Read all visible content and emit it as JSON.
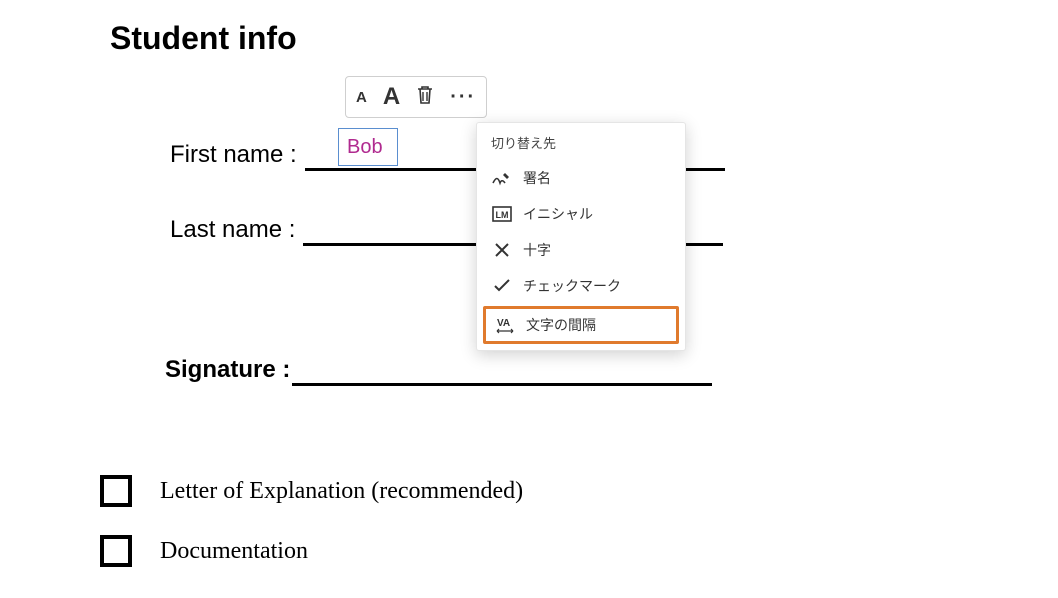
{
  "title": "Student info",
  "form": {
    "first_name": {
      "label": "First name :",
      "value": "Bob"
    },
    "last_name": {
      "label": "Last name :"
    },
    "signature": {
      "label": "Signature :"
    }
  },
  "toolbar": {
    "small_a": "A",
    "big_a": "A"
  },
  "menu": {
    "title": "切り替え先",
    "items": {
      "signature": "署名",
      "initials": "イニシャル",
      "cross": "十字",
      "checkmark": "チェックマーク",
      "spacing": "文字の間隔"
    }
  },
  "checks": {
    "letter": "Letter of Explanation (recommended)",
    "documentation": "Documentation"
  }
}
